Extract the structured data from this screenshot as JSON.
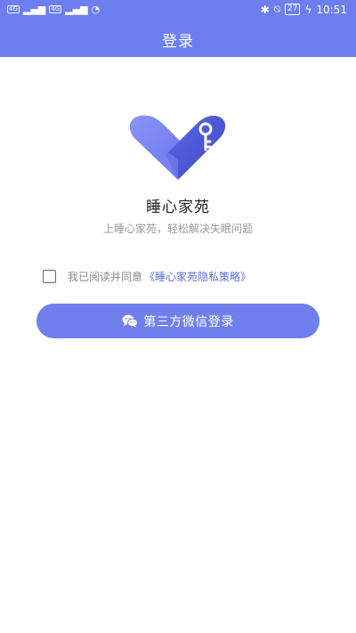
{
  "status_bar": {
    "left": [
      "4G",
      "4G",
      "4G"
    ],
    "battery": "27",
    "time": "10:51"
  },
  "header": {
    "title": "登录"
  },
  "app": {
    "name": "睡心家苑",
    "slogan": "上睡心家苑，轻松解决失眠问题"
  },
  "agreement": {
    "text": "我已阅读并同意",
    "link": "《睡心家苑隐私策略》"
  },
  "login": {
    "label": "第三方微信登录"
  },
  "colors": {
    "primary": "#6C7EF0",
    "link": "#5A6FE6"
  }
}
